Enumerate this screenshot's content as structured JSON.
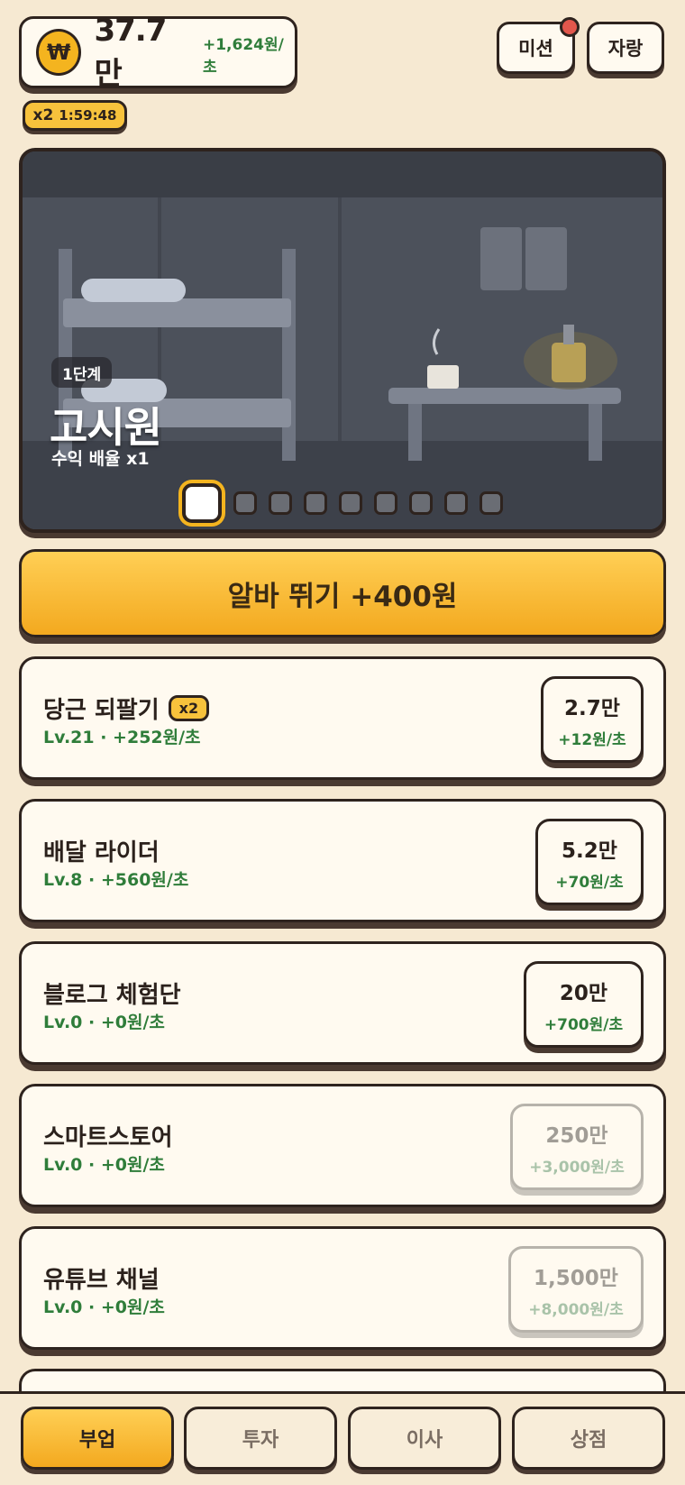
{
  "header": {
    "currency_symbol": "₩",
    "balance": "37.7만",
    "rate": "+1,624원/초",
    "mission_label": "미션",
    "brag_label": "자랑"
  },
  "boost": {
    "multiplier": "x2",
    "timer": "1:59:48"
  },
  "scene": {
    "stage_label": "1단계",
    "stage_name": "고시원",
    "multiplier_text": "수익 배율 x1",
    "total_stages": 9,
    "current_stage": 1
  },
  "work_button": {
    "label": "알바 뛰기 +400원"
  },
  "jobs": [
    {
      "name": "당근 되팔기",
      "badge": "x2",
      "stats": "Lv.21 · +252원/초",
      "cost": "2.7만",
      "gain": "+12원/초",
      "locked": false
    },
    {
      "name": "배달 라이더",
      "badge": "",
      "stats": "Lv.8 · +560원/초",
      "cost": "5.2만",
      "gain": "+70원/초",
      "locked": false
    },
    {
      "name": "블로그 체험단",
      "badge": "",
      "stats": "Lv.0 · +0원/초",
      "cost": "20만",
      "gain": "+700원/초",
      "locked": false
    },
    {
      "name": "스마트스토어",
      "badge": "",
      "stats": "Lv.0 · +0원/초",
      "cost": "250만",
      "gain": "+3,000원/초",
      "locked": true
    },
    {
      "name": "유튜브 채널",
      "badge": "",
      "stats": "Lv.0 · +0원/초",
      "cost": "1,500만",
      "gain": "+8,000원/초",
      "locked": true
    }
  ],
  "nav": {
    "items": [
      {
        "label": "부업",
        "active": true
      },
      {
        "label": "투자",
        "active": false
      },
      {
        "label": "이사",
        "active": false
      },
      {
        "label": "상점",
        "active": false
      }
    ]
  }
}
